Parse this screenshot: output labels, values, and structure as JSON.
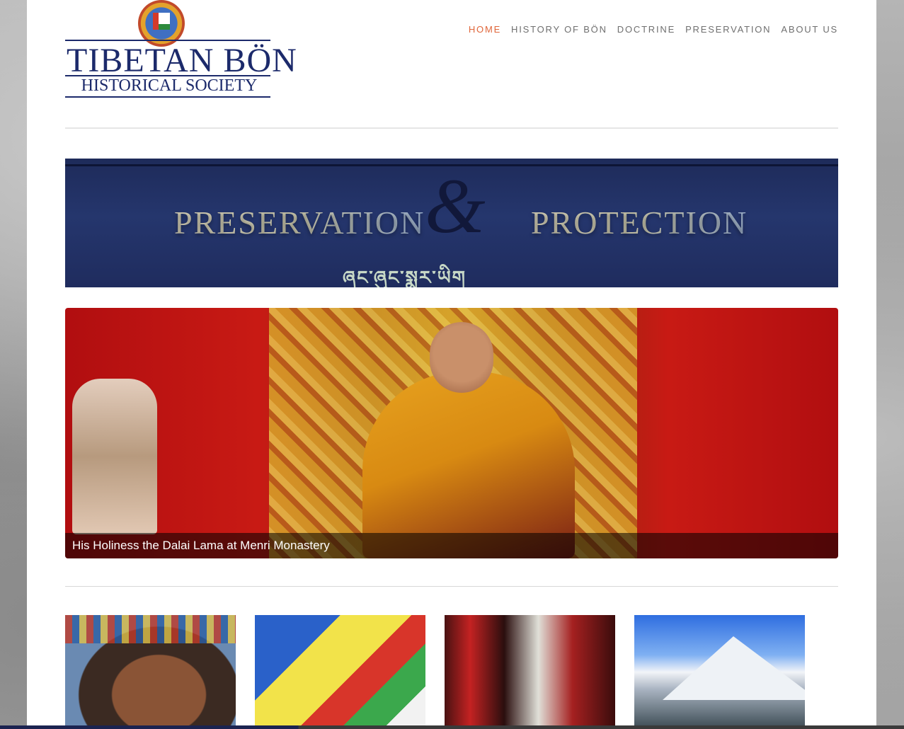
{
  "logo": {
    "title": "TIBETAN BÖN",
    "subtitle": "HISTORICAL SOCIETY"
  },
  "nav": {
    "items": [
      {
        "label": "HOME",
        "active": true
      },
      {
        "label": "HISTORY OF BÖN",
        "active": false
      },
      {
        "label": "DOCTRINE",
        "active": false
      },
      {
        "label": "PRESERVATION",
        "active": false
      },
      {
        "label": "ABOUT US",
        "active": false
      }
    ]
  },
  "banner": {
    "left_text": "PRESERVATION",
    "ampersand": "&",
    "right_text": "PROTECTION",
    "script_text": "ཞང་ཞུང་སྨར་ཡིག"
  },
  "slider": {
    "caption": "His Holiness the Dalai Lama at Menri Monastery"
  },
  "colors": {
    "accent": "#e0663a",
    "nav_text": "#6f6f6f",
    "logo_navy": "#1c2a6b",
    "banner_bg": "#25366d"
  }
}
